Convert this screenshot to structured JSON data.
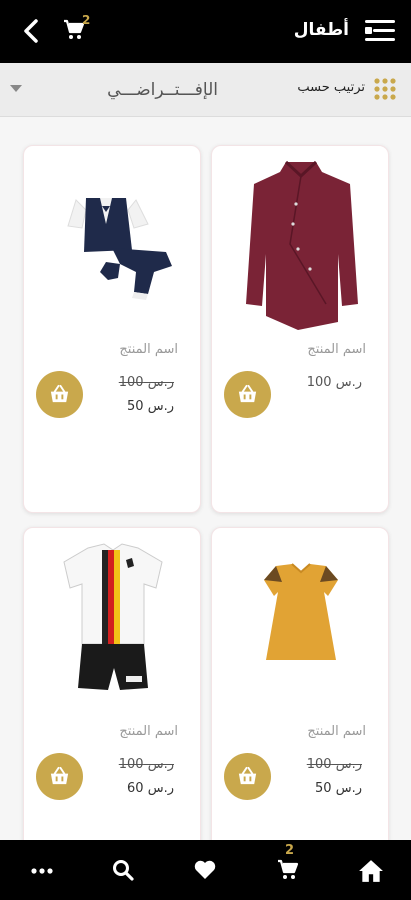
{
  "header": {
    "title": "أطفال",
    "cart_count": "2"
  },
  "sort": {
    "label": "ترتيب حسب",
    "selected": "الإفـــتــراضـــي"
  },
  "products": [
    {
      "name": "اسم المنتج",
      "price": "ر.س 100",
      "old_price": "",
      "image": "maroon-shirt-image"
    },
    {
      "name": "اسم المنتج",
      "price": "ر.س 50",
      "old_price": "ر.س 100",
      "image": "kids-suit-image"
    },
    {
      "name": "اسم المنتج",
      "price": "ر.س 50",
      "old_price": "ر.س 100",
      "image": "yellow-dress-image"
    },
    {
      "name": "اسم المنتج",
      "price": "ر.س 60",
      "old_price": "ر.س 100",
      "image": "jersey-image"
    }
  ],
  "bottom_nav": {
    "cart_count": "2",
    "items": [
      "home-icon",
      "cart-icon",
      "heart-icon",
      "search-icon",
      "more-icon"
    ]
  },
  "colors": {
    "accent": "#c9a84c",
    "bar": "#000000"
  }
}
